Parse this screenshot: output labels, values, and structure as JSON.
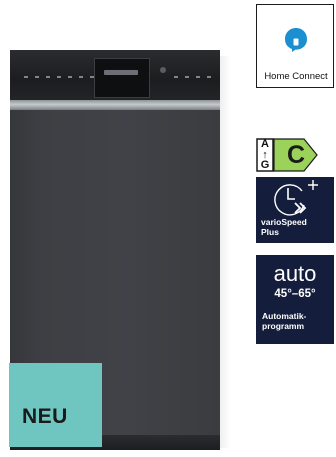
{
  "product": {
    "badge": "NEU"
  },
  "features": {
    "home_connect": {
      "icon": "home-connect-icon",
      "label": "Home Connect"
    },
    "energy": {
      "scale_top": "A",
      "scale_arrow": "↑",
      "scale_bottom": "G",
      "class": "C",
      "color": "#9bd25a"
    },
    "vario_speed": {
      "icon": "clock-speed-icon",
      "label": "varioSpeed\nPlus"
    },
    "auto_program": {
      "word": "auto",
      "temperature": "45°–65°",
      "label": "Automatik-\nprogramm"
    }
  },
  "colors": {
    "navy": "#141e3c",
    "neu_badge": "#6fc6c1",
    "home_connect_blue": "#1c8fd0"
  }
}
